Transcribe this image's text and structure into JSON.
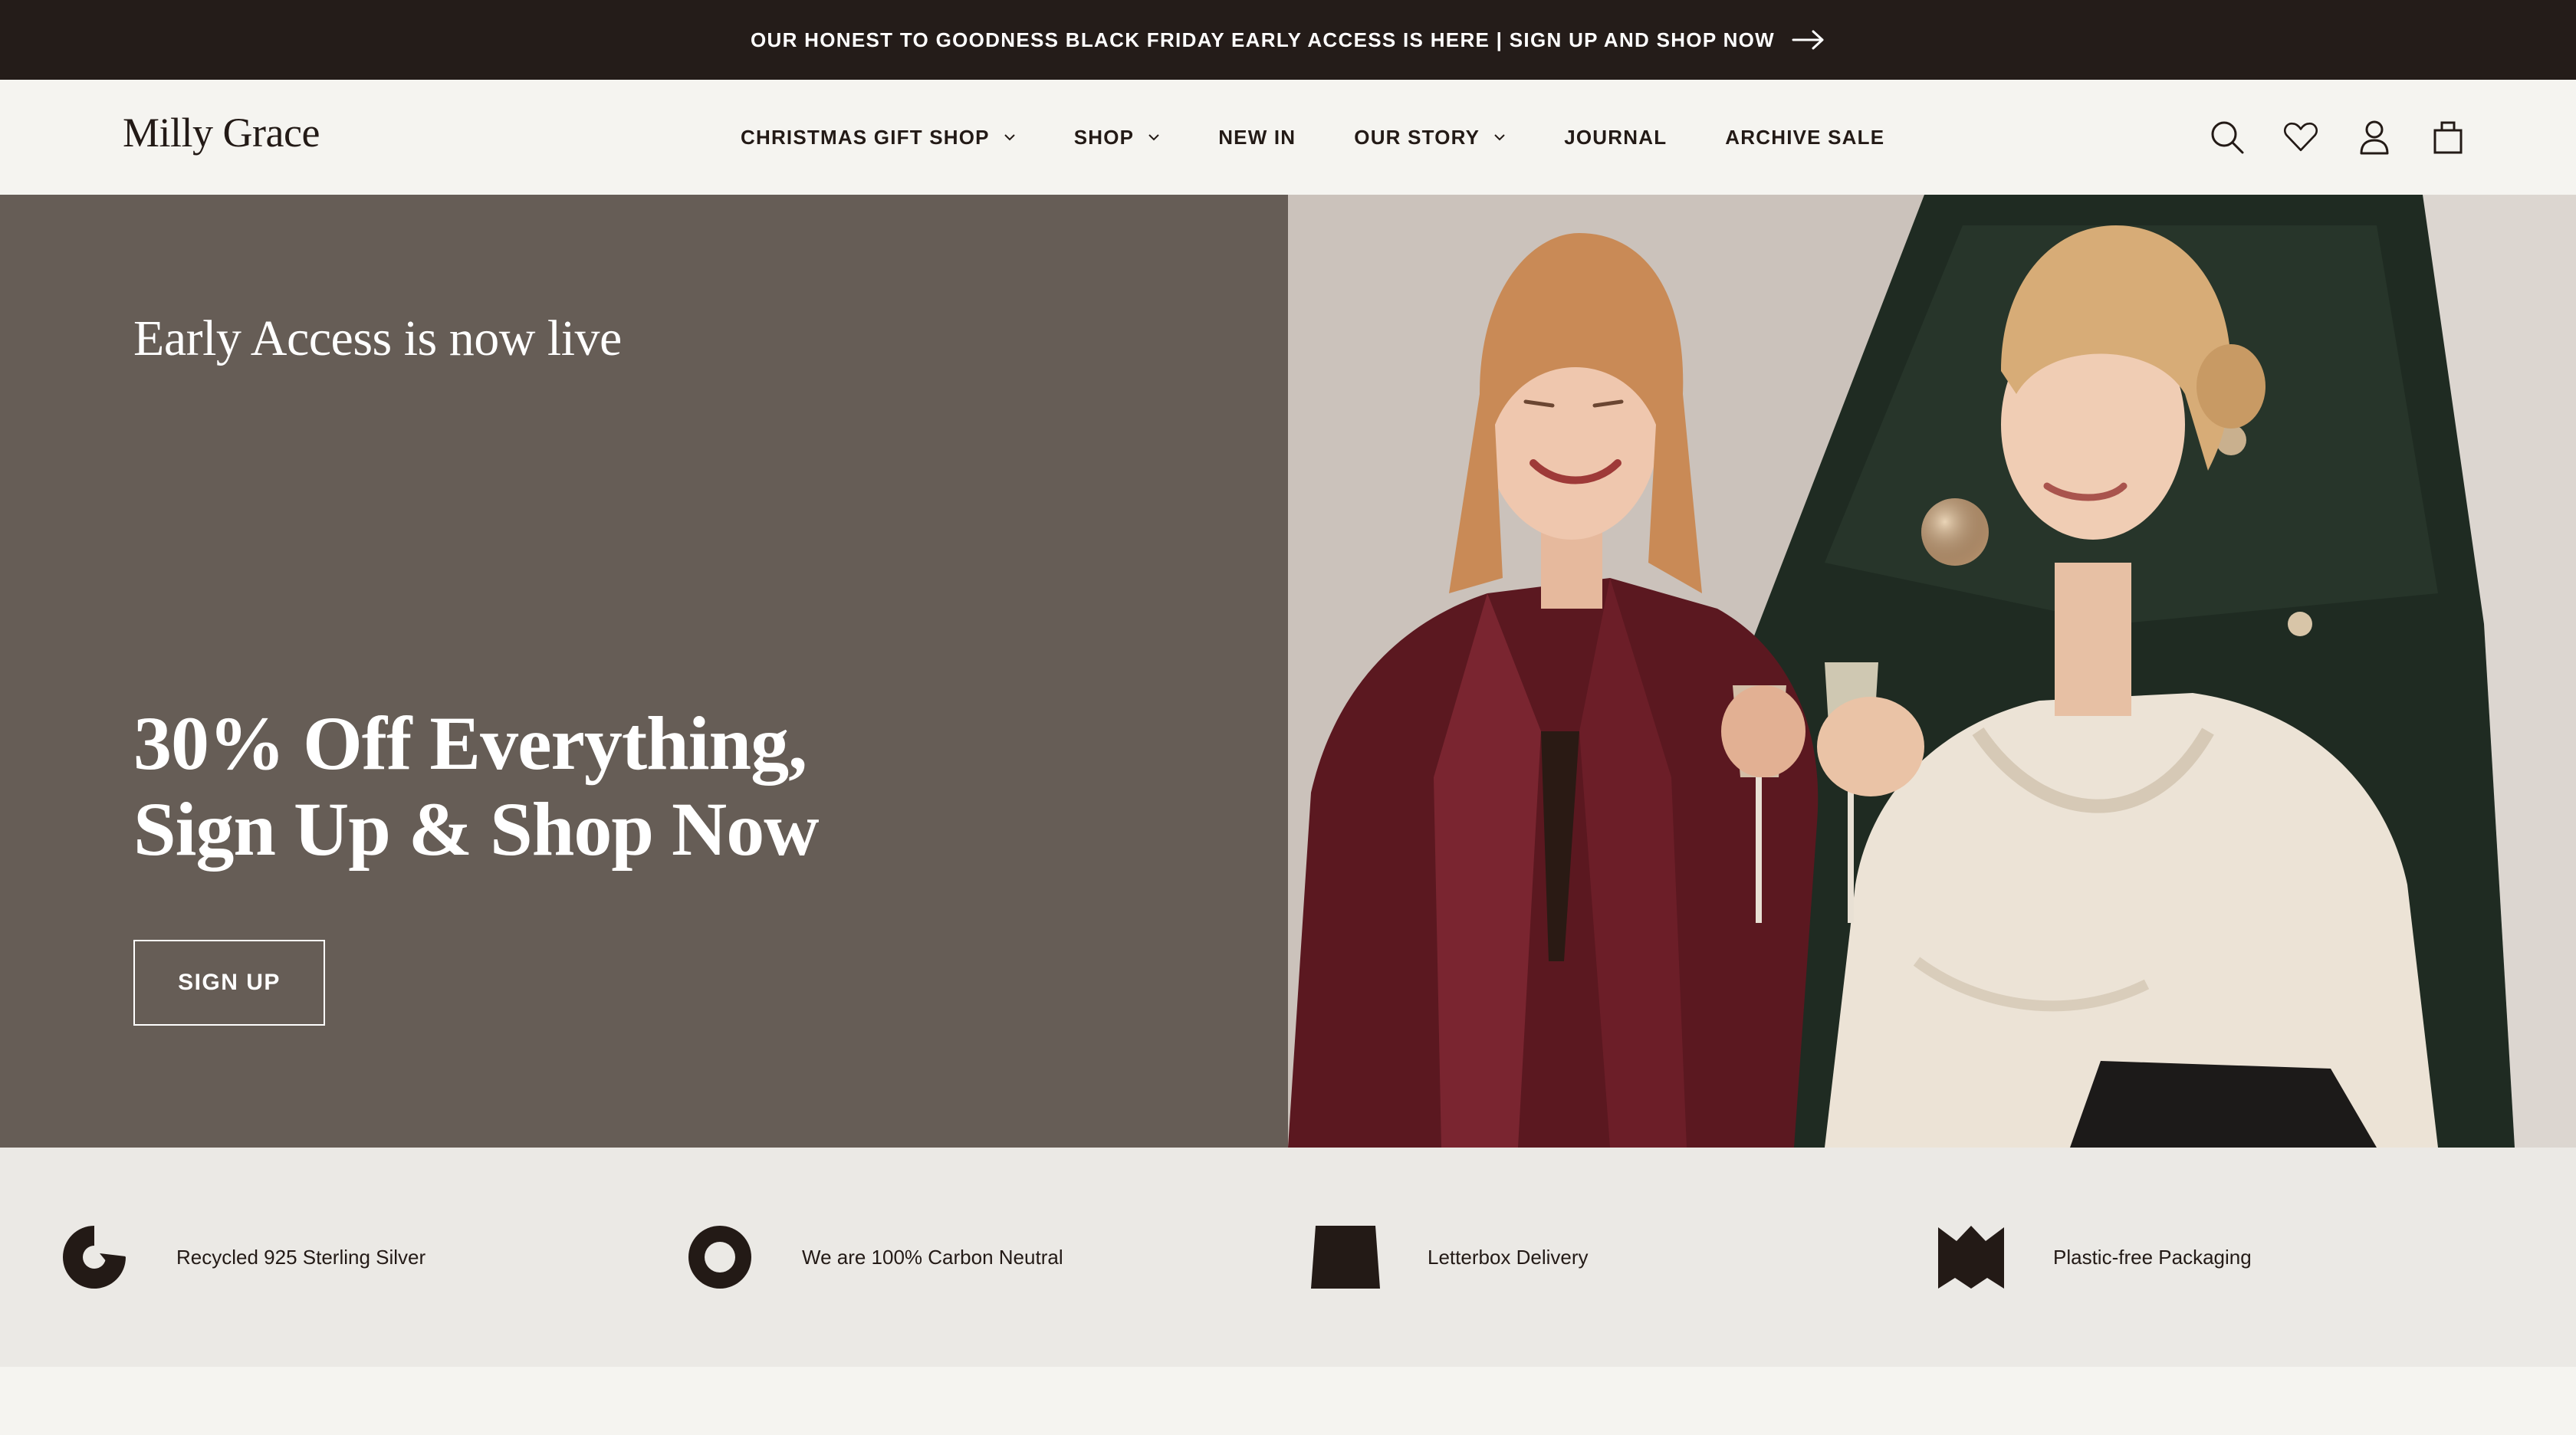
{
  "announcement": {
    "text": "OUR HONEST TO GOODNESS BLACK FRIDAY EARLY ACCESS IS HERE | SIGN UP AND SHOP NOW",
    "icon": "arrow-right-icon"
  },
  "header": {
    "logo": "Milly Grace",
    "nav": [
      {
        "label": "CHRISTMAS GIFT SHOP",
        "has_dropdown": true
      },
      {
        "label": "SHOP",
        "has_dropdown": true
      },
      {
        "label": "NEW IN",
        "has_dropdown": false
      },
      {
        "label": "OUR STORY",
        "has_dropdown": true
      },
      {
        "label": "JOURNAL",
        "has_dropdown": false
      },
      {
        "label": "ARCHIVE SALE",
        "has_dropdown": false
      }
    ],
    "icons": [
      "search-icon",
      "wishlist-heart-icon",
      "account-icon",
      "bag-icon"
    ]
  },
  "hero": {
    "eyebrow": "Early Access is now live",
    "headline_line1": "30% Off Everything,",
    "headline_line2": "Sign Up & Shop Now",
    "cta": "SIGN UP",
    "image_alt": "photo-two-women-champagne-christmas-tree",
    "left_bg": "#665d56"
  },
  "features": [
    {
      "icon": "recycle-icon",
      "label": "Recycled 925 Sterling Silver"
    },
    {
      "icon": "carbon-neutral-icon",
      "label": "We are 100% Carbon Neutral"
    },
    {
      "icon": "letterbox-icon",
      "label": "Letterbox Delivery"
    },
    {
      "icon": "plastic-free-icon",
      "label": "Plastic-free Packaging"
    }
  ],
  "colors": {
    "dark": "#241c19",
    "background": "#f5f4f0",
    "strip": "#ebe9e5"
  }
}
